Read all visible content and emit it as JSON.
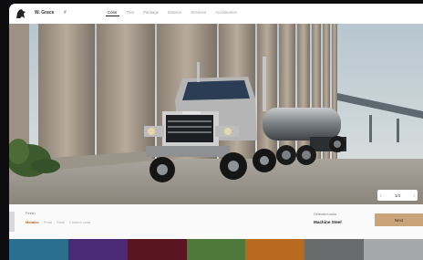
{
  "header": {
    "brand": "W. Grace",
    "brand_sub": "#",
    "nav": [
      "Color",
      "Trim",
      "Package",
      "Exterior",
      "Services",
      "Accessories"
    ],
    "active_nav": 0
  },
  "hero": {
    "pager_prev": "‹",
    "pager_text": "1/4",
    "pager_next": "›"
  },
  "config": {
    "section_label": "Finish",
    "finish_options": [
      "Metallic",
      "Pearl",
      "Solid",
      "Custom color"
    ],
    "active_finish": 0,
    "color_label": "Selected color",
    "color_name": "Machine Steel",
    "next_label": "Next"
  },
  "swatches": {
    "colors": [
      "#2b6f8e",
      "#4a2a74",
      "#5a1620",
      "#4d7a3a",
      "#b86a1f",
      "#6a6b6d",
      "#a5a7a9"
    ]
  }
}
